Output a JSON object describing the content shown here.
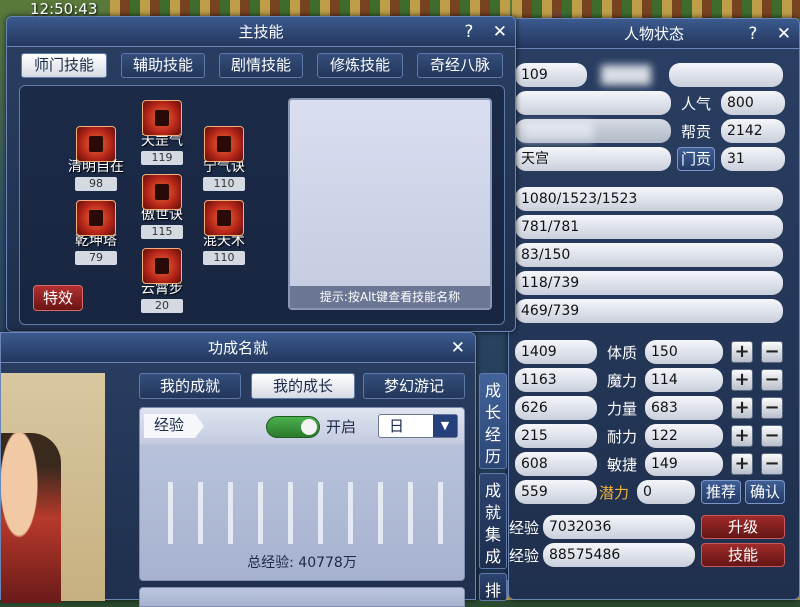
{
  "clock": "12:50:43",
  "skills_window": {
    "title": "主技能",
    "help": "?",
    "close": "✕",
    "tabs": [
      "师门技能",
      "辅助技能",
      "剧情技能",
      "修炼技能",
      "奇经八脉"
    ],
    "active_tab": 0,
    "skills": [
      {
        "name": "天罡气",
        "level": "119"
      },
      {
        "name": "清明自在",
        "level": "98"
      },
      {
        "name": "宁气诀",
        "level": "110"
      },
      {
        "name": "傲世诀",
        "level": "115"
      },
      {
        "name": "乾坤塔",
        "level": "79"
      },
      {
        "name": "混天术",
        "level": "110"
      },
      {
        "name": "云霄步",
        "level": "20"
      }
    ],
    "hint": "提示:按Alt键查看技能名称",
    "effect_button": "特效"
  },
  "achievement_window": {
    "title": "功成名就",
    "close": "✕",
    "tabs": [
      "我的成就",
      "我的成长",
      "梦幻游记"
    ],
    "active_tab": 1,
    "side_tabs": [
      "成长经历",
      "成就集成",
      "排"
    ],
    "exp_label": "经验",
    "toggle_label": "开启",
    "period": "日",
    "total_exp": "总经验: 40778万"
  },
  "status_window": {
    "title": "人物状态",
    "help": "?",
    "close": "✕",
    "level": "109",
    "popularity_label": "人气",
    "popularity": "800",
    "contribution_label": "帮贡",
    "contribution": "2142",
    "sect": "天宫",
    "sect_contrib_label": "门贡",
    "sect_contrib": "31",
    "hp": "1080/1523/1523",
    "mp": "781/781",
    "anger": "83/150",
    "vigor": "118/739",
    "energy": "469/739",
    "stats": [
      {
        "value": "1409",
        "label": "体质",
        "points": "150"
      },
      {
        "value": "1163",
        "label": "魔力",
        "points": "114"
      },
      {
        "value": "626",
        "label": "力量",
        "points": "683"
      },
      {
        "value": "215",
        "label": "耐力",
        "points": "122"
      },
      {
        "value": "608",
        "label": "敏捷",
        "points": "149"
      }
    ],
    "plus": "+",
    "minus": "−",
    "extra_value": "559",
    "potential_label": "潜力",
    "potential": "0",
    "recommend_button": "推荐",
    "confirm_button": "确认",
    "exp_label": "经验",
    "exp": "7032036",
    "upgrade_button": "升级",
    "exp2_label": "经验",
    "exp2": "88575486",
    "skills_button": "技能"
  }
}
